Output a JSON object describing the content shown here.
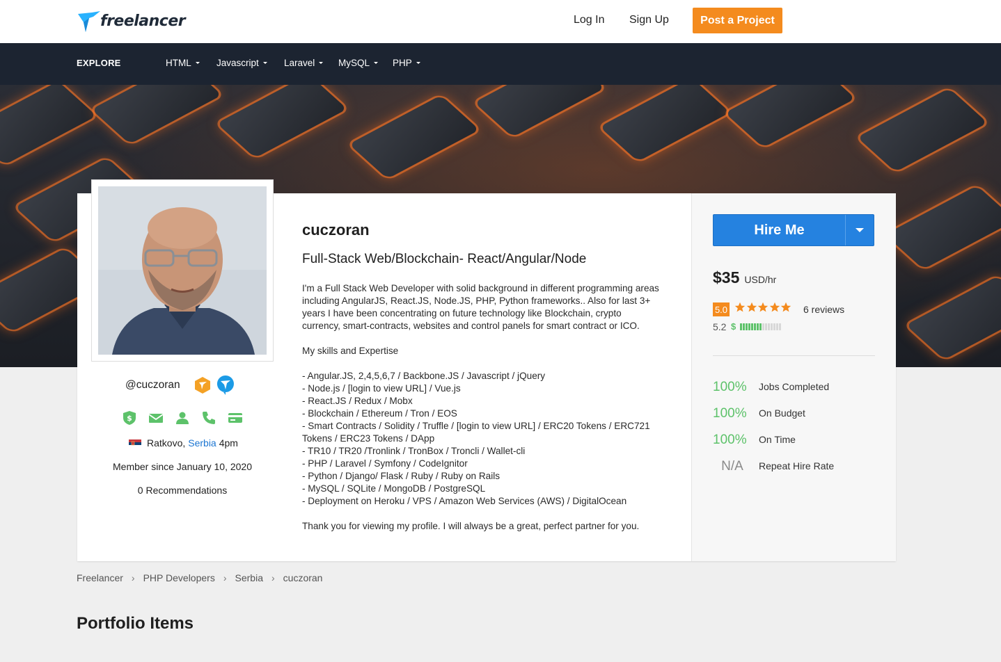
{
  "header": {
    "logo_text": "freelancer",
    "login_label": "Log In",
    "signup_label": "Sign Up",
    "post_label": "Post a Project"
  },
  "explore": {
    "label": "EXPLORE",
    "items": [
      {
        "label": "HTML"
      },
      {
        "label": "Javascript"
      },
      {
        "label": "Laravel"
      },
      {
        "label": "MySQL"
      },
      {
        "label": "PHP"
      }
    ]
  },
  "profile": {
    "name": "cuczoran",
    "handle": "@cuczoran",
    "tagline": "Full-Stack Web/Blockchain- React/Angular/Node",
    "bio": "I'm a Full Stack Web Developer with solid background in different programming areas\nincluding AngularJS, React.JS, Node.JS, PHP, Python frameworks.. Also for last 3+\nyears I have been concentrating on future technology like Blockchain, crypto\ncurrency, smart-contracts, websites and control panels for smart contract or ICO.\n\nMy skills and Expertise\n\n- Angular.JS, 2,4,5,6,7 / Backbone.JS / Javascript / jQuery\n- Node.js / [login to view URL] / Vue.js\n- React.JS / Redux / Mobx\n- Blockchain / Ethereum / Tron / EOS\n- Smart Contracts / Solidity / Truffle / [login to view URL] / ERC20 Tokens / ERC721\nTokens / ERC23 Tokens / DApp\n- TR10 / TR20 /Tronlink / TronBox / Troncli / Wallet-cli\n- PHP / Laravel / Symfony / CodeIgnitor\n- Python / Django/ Flask / Ruby / Ruby on Rails\n- MySQL / SQLite / MongoDB / PostgreSQL\n- Deployment on Heroku / VPS / Amazon Web Services (AWS) / DigitalOcean\n\nThank you for viewing my profile. I will always be a great, perfect partner for you.",
    "location_city": "Ratkovo,",
    "location_country": "Serbia",
    "location_time": "4pm",
    "member_since": "Member since January 10, 2020",
    "recommendations": "0 Recommendations",
    "verification_icons": [
      "payment-verified-icon",
      "email-verified-icon",
      "identity-verified-icon",
      "phone-verified-icon",
      "card-verified-icon"
    ]
  },
  "hire": {
    "button_label": "Hire Me",
    "rate_amount": "$35",
    "rate_unit": "USD/hr",
    "rating": "5.0",
    "stars": 5,
    "reviews": "6 reviews",
    "earnings_score": "5.2",
    "earnings_fill": 0.55
  },
  "stats": [
    {
      "value": "100%",
      "label": "Jobs Completed"
    },
    {
      "value": "100%",
      "label": "On Budget"
    },
    {
      "value": "100%",
      "label": "On Time"
    },
    {
      "value": "N/A",
      "label": "Repeat Hire Rate"
    }
  ],
  "breadcrumb": [
    "Freelancer",
    "PHP Developers",
    "Serbia",
    "cuczoran"
  ],
  "portfolio_title": "Portfolio Items",
  "colors": {
    "accent_orange": "#f48b1e",
    "hire_blue": "#2582e0",
    "nav_dark": "#1c2431",
    "verified_green": "#5dc26a",
    "link_blue": "#1c76d2"
  }
}
